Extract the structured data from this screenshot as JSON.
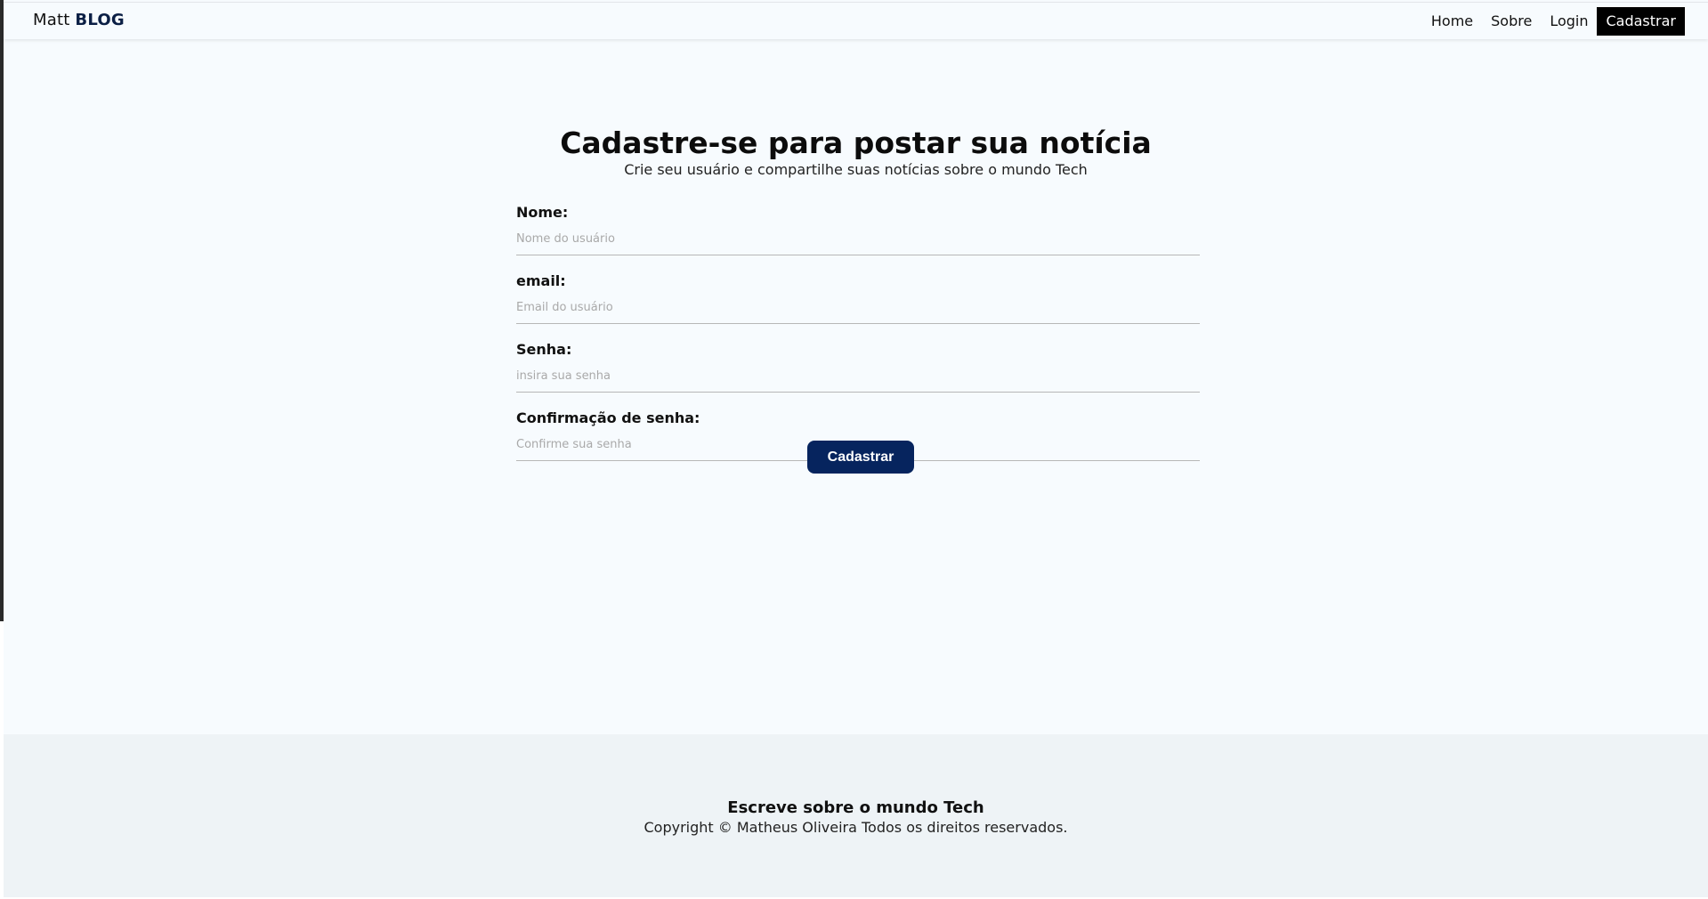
{
  "navbar": {
    "brand_light": "Matt",
    "brand_strong": "BLOG",
    "links": [
      {
        "label": "Home"
      },
      {
        "label": "Sobre"
      },
      {
        "label": "Login"
      },
      {
        "label": "Cadastrar",
        "active": true
      }
    ]
  },
  "main": {
    "title": "Cadastre-se para postar sua notícia",
    "subtitle": "Crie seu usuário e compartilhe suas notícias sobre o mundo Tech",
    "fields": [
      {
        "label": "Nome:",
        "placeholder": "Nome do usuário",
        "value": ""
      },
      {
        "label": "email:",
        "placeholder": "Email do usuário",
        "value": ""
      },
      {
        "label": "Senha:",
        "placeholder": "insira sua senha",
        "value": ""
      },
      {
        "label": "Confirmação de senha:",
        "placeholder": "Confirme sua senha",
        "value": ""
      }
    ],
    "submit_label": "Cadastrar"
  },
  "footer": {
    "title": "Escreve sobre o mundo Tech",
    "copyright": "Copyright © Matheus Oliveira Todos os direitos reservados."
  },
  "colors": {
    "background": "#f7fbfe",
    "footer_background": "#eef3f6",
    "accent_button": "#06245e",
    "active_nav": "#000000"
  }
}
